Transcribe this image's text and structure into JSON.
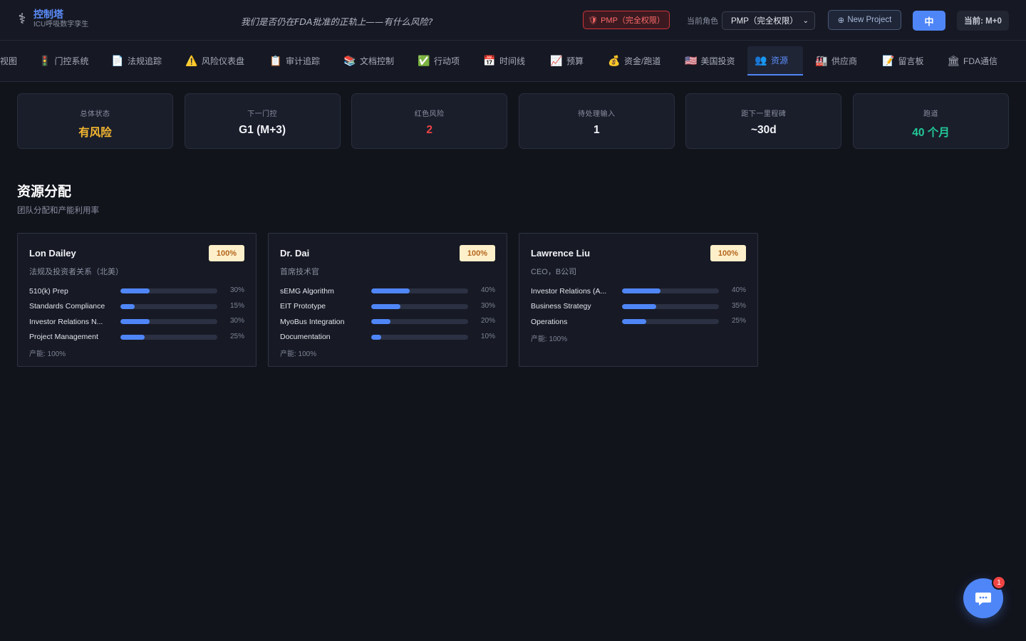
{
  "header": {
    "brand_title": "控制塔",
    "brand_subtitle": "ICU呼吸数字孪生",
    "tagline": "我们是否仍在FDA批准的正轨上——有什么风险?",
    "pmp_badge": "PMP（完全权限）",
    "role_label": "当前角色",
    "role_value": "PMP（完全权限）",
    "new_project": "New Project",
    "lang": "中",
    "current_month": "当前: M+0"
  },
  "tabs": [
    {
      "label": "视图",
      "icon": "view-icon",
      "glyph": ""
    },
    {
      "label": "门控系统",
      "icon": "traffic-light-icon",
      "glyph": "🚦"
    },
    {
      "label": "法规追踪",
      "icon": "document-icon",
      "glyph": "📄"
    },
    {
      "label": "风险仪表盘",
      "icon": "warning-icon",
      "glyph": "⚠️"
    },
    {
      "label": "审计追踪",
      "icon": "clipboard-icon",
      "glyph": "📋"
    },
    {
      "label": "文档控制",
      "icon": "books-icon",
      "glyph": "📚"
    },
    {
      "label": "行动项",
      "icon": "check-icon",
      "glyph": "✅"
    },
    {
      "label": "时间线",
      "icon": "calendar-icon",
      "glyph": "📅"
    },
    {
      "label": "预算",
      "icon": "chart-icon",
      "glyph": "📈"
    },
    {
      "label": "资金/跑道",
      "icon": "money-bag-icon",
      "glyph": "💰"
    },
    {
      "label": "美国投资",
      "icon": "us-flag-icon",
      "glyph": "🇺🇸"
    },
    {
      "label": "资源",
      "icon": "people-icon",
      "glyph": "👥"
    },
    {
      "label": "供应商",
      "icon": "factory-icon",
      "glyph": "🏭"
    },
    {
      "label": "留言板",
      "icon": "memo-icon",
      "glyph": "📝"
    },
    {
      "label": "FDA通信",
      "icon": "building-icon",
      "glyph": "🏛"
    }
  ],
  "active_tab": "资源",
  "stats": [
    {
      "label": "总体状态",
      "value": "有风险",
      "color": "#f5b731"
    },
    {
      "label": "下一门控",
      "value": "G1 (M+3)",
      "color": "#f2f3f7"
    },
    {
      "label": "红色风险",
      "value": "2",
      "color": "#ef4444"
    },
    {
      "label": "待处理输入",
      "value": "1",
      "color": "#f2f3f7"
    },
    {
      "label": "距下一里程碑",
      "value": "~30d",
      "color": "#f2f3f7"
    },
    {
      "label": "跑道",
      "value": "40 个月",
      "color": "#22c997"
    }
  ],
  "section": {
    "title": "资源分配",
    "subtitle": "团队分配和产能利用率"
  },
  "people": [
    {
      "name": "Lon Dailey",
      "role": "法规及投资者关系（北美）",
      "utilization": "100%",
      "allocations": [
        {
          "name": "510(k) Prep",
          "pct": 30,
          "pct_label": "30%"
        },
        {
          "name": "Standards Compliance",
          "pct": 15,
          "pct_label": "15%"
        },
        {
          "name": "Investor Relations N...",
          "pct": 30,
          "pct_label": "30%"
        },
        {
          "name": "Project Management",
          "pct": 25,
          "pct_label": "25%"
        }
      ],
      "capacity": "产能: 100%"
    },
    {
      "name": "Dr. Dai",
      "role": "首席技术官",
      "utilization": "100%",
      "allocations": [
        {
          "name": "sEMG Algorithm",
          "pct": 40,
          "pct_label": "40%"
        },
        {
          "name": "EIT Prototype",
          "pct": 30,
          "pct_label": "30%"
        },
        {
          "name": "MyoBus Integration",
          "pct": 20,
          "pct_label": "20%"
        },
        {
          "name": "Documentation",
          "pct": 10,
          "pct_label": "10%"
        }
      ],
      "capacity": "产能: 100%"
    },
    {
      "name": "Lawrence Liu",
      "role": "CEO，B公司",
      "utilization": "100%",
      "allocations": [
        {
          "name": "Investor Relations (A...",
          "pct": 40,
          "pct_label": "40%"
        },
        {
          "name": "Business Strategy",
          "pct": 35,
          "pct_label": "35%"
        },
        {
          "name": "Operations",
          "pct": 25,
          "pct_label": "25%"
        }
      ],
      "capacity": "产能: 100%"
    }
  ],
  "chat": {
    "unread": "1"
  }
}
